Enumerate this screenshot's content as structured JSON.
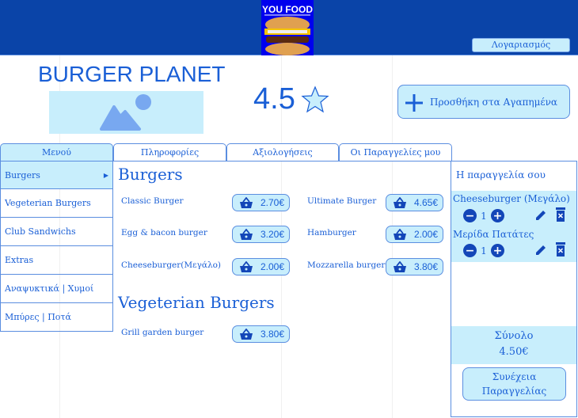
{
  "header": {
    "logo_text": "YOU FOOD",
    "account_label": "Λογαριασμός"
  },
  "restaurant": {
    "name": "BURGER PLANET",
    "rating": "4.5",
    "favorite_label": "Προσθήκη στα Αγαπημένα"
  },
  "tabs": [
    {
      "label": "Μενού",
      "active": true
    },
    {
      "label": "Πληροφορίες"
    },
    {
      "label": "Αξιολογήσεις"
    },
    {
      "label": "Οι Παραγγελίες μου"
    }
  ],
  "sidebar": {
    "items": [
      {
        "label": "Burgers",
        "active": true
      },
      {
        "label": "Vegeterian Burgers"
      },
      {
        "label": "Club Sandwichs"
      },
      {
        "label": "Extras"
      },
      {
        "label": "Αναψυκτικά | Χυμοί"
      },
      {
        "label": "Μπύρες | Ποτά"
      }
    ]
  },
  "menu": {
    "sections": [
      {
        "title": "Burgers",
        "items": [
          {
            "name": "Classic Burger",
            "price": "2.70€"
          },
          {
            "name": "Ultimate Burger",
            "price": "4.65€"
          },
          {
            "name": "Egg & bacon burger",
            "price": "3.20€"
          },
          {
            "name": "Hamburger",
            "price": "2.00€"
          },
          {
            "name": "Cheeseburger(Μεγάλο)",
            "price": "2.00€"
          },
          {
            "name": "Mozzarella burger",
            "price": "3.80€"
          }
        ]
      },
      {
        "title": "Vegeterian Burgers",
        "items": [
          {
            "name": "Grill garden burger",
            "price": "3.80€"
          }
        ]
      }
    ]
  },
  "order": {
    "title": "Η παραγγελία σου",
    "items": [
      {
        "name": "Cheeseburger (Μεγάλο)",
        "qty": "1"
      },
      {
        "name": "Μερίδα Πατάτες",
        "qty": "1"
      }
    ],
    "total_label": "Σύνολο",
    "total": "4.50€",
    "continue_label_1": "Συνέχεια",
    "continue_label_2": "Παραγγελίας"
  },
  "colors": {
    "header": "#0a44a8",
    "accent": "#1a5fd6",
    "light": "#c8eefc"
  }
}
